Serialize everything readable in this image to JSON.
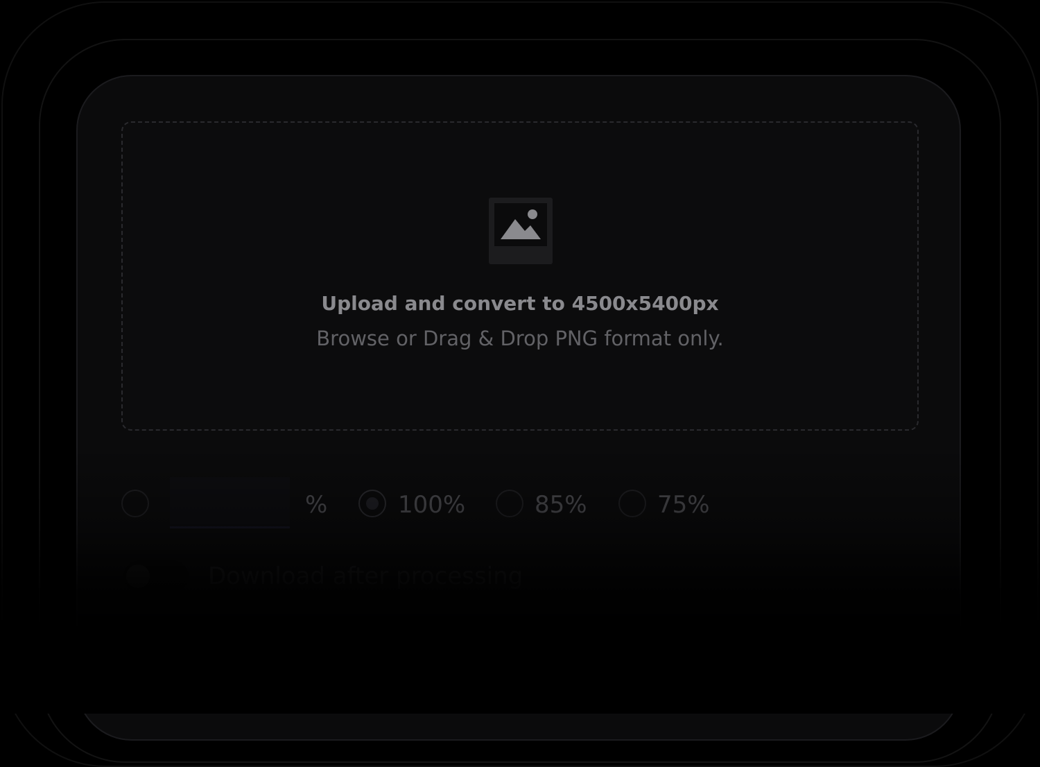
{
  "upload": {
    "title": "Upload and convert to 4500x5400px",
    "subtitle": "Browse or Drag & Drop PNG format only."
  },
  "scale_options": {
    "custom_unit": "%",
    "custom_value": "",
    "options": [
      {
        "label": "100%",
        "selected": true
      },
      {
        "label": "85%",
        "selected": false
      },
      {
        "label": "75%",
        "selected": false
      }
    ]
  },
  "download": {
    "label": "Download after processing",
    "enabled": false
  },
  "icons": {
    "upload": "image-icon"
  }
}
